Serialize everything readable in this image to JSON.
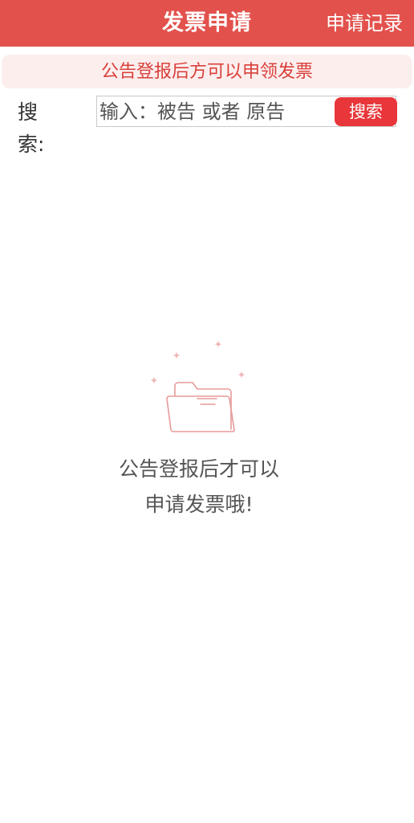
{
  "header": {
    "title": "发票申请",
    "action_label": "申请记录"
  },
  "notice": {
    "text": "公告登报后方可以申领发票"
  },
  "search": {
    "label": "搜索:",
    "placeholder": "输入：被告 或者 原告",
    "value": "",
    "button_label": "搜索"
  },
  "empty_state": {
    "icon": "empty-folder-icon",
    "line1": "公告登报后才可以",
    "line2": "申请发票哦!"
  },
  "colors": {
    "header_bg": "#e2514c",
    "notice_bg": "#fdeeee",
    "notice_text": "#d8403a",
    "search_button_bg": "#e8363a",
    "icon_stroke": "#e79a9a"
  }
}
